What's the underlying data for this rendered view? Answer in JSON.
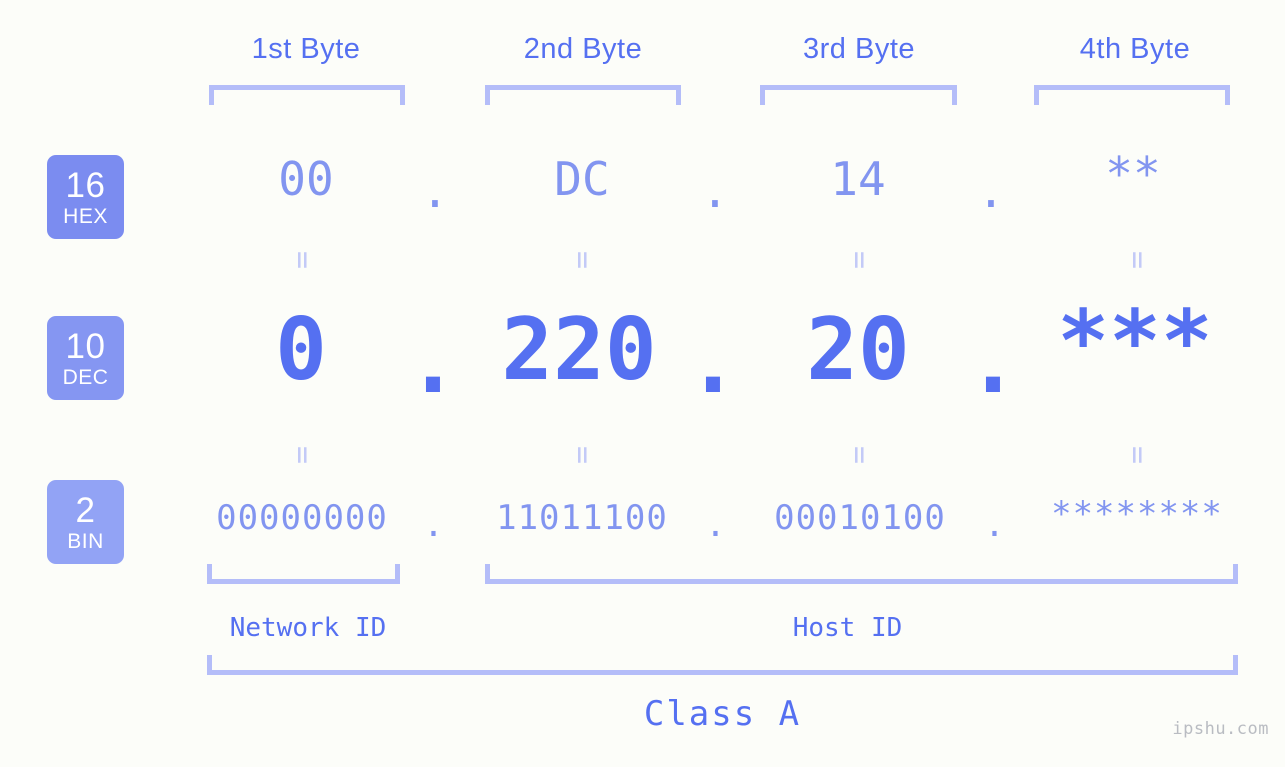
{
  "watermark": "ipshu.com",
  "colors": {
    "background": "#fcfdf9",
    "accent_strong": "#5570f1",
    "accent_mid": "#8295f0",
    "accent_light": "#b4bdf9",
    "badge_hex": "#7b8cf0",
    "badge_dec": "#8596f2",
    "badge_bin": "#92a3f5",
    "equals_mark": "#c3caf7",
    "watermark": "#b9bcc2"
  },
  "byte_headers": [
    {
      "label": "1st Byte"
    },
    {
      "label": "2nd Byte"
    },
    {
      "label": "3rd Byte"
    },
    {
      "label": "4th Byte"
    }
  ],
  "radix_badges": [
    {
      "number": "16",
      "name": "HEX"
    },
    {
      "number": "10",
      "name": "DEC"
    },
    {
      "number": "2",
      "name": "BIN"
    }
  ],
  "rows": {
    "hex": {
      "radix": "16",
      "radix_name": "HEX",
      "values": [
        "00",
        "DC",
        "14",
        "**"
      ],
      "separator": "."
    },
    "dec": {
      "radix": "10",
      "radix_name": "DEC",
      "values": [
        "0",
        "220",
        "20",
        "***"
      ],
      "separator": "."
    },
    "bin": {
      "radix": "2",
      "radix_name": "BIN",
      "values": [
        "00000000",
        "11011100",
        "00010100",
        "********"
      ],
      "separator": "."
    }
  },
  "equals_mark": "=",
  "sections": {
    "network_id": "Network ID",
    "host_id": "Host ID",
    "class": "Class A"
  }
}
